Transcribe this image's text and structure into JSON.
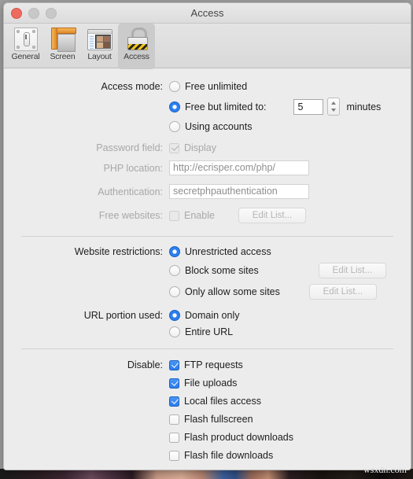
{
  "window": {
    "title": "Access",
    "traffic_lights": [
      "close-button",
      "minimize-button",
      "zoom-button"
    ]
  },
  "toolbar": {
    "tabs": [
      {
        "label": "General",
        "icon": "general-panel-icon",
        "selected": false
      },
      {
        "label": "Screen",
        "icon": "ruler-screen-icon",
        "selected": false
      },
      {
        "label": "Layout",
        "icon": "window-layout-icon",
        "selected": false
      },
      {
        "label": "Access",
        "icon": "padlock-icon",
        "selected": true
      }
    ]
  },
  "sections": {
    "access_mode": {
      "label": "Access mode:",
      "options": [
        {
          "label": "Free unlimited",
          "selected": false
        },
        {
          "label": "Free but limited to:",
          "selected": true
        },
        {
          "label": "Using accounts",
          "selected": false
        }
      ],
      "minutes_value": "5",
      "minutes_unit": "minutes",
      "stepper": "minutes-stepper"
    },
    "password_field": {
      "label": "Password field:",
      "checkbox_label": "Display",
      "checked": true,
      "enabled": false
    },
    "php_location": {
      "label": "PHP location:",
      "value": "http://ecrisper.com/php/",
      "enabled": false
    },
    "authentication": {
      "label": "Authentication:",
      "value": "secretphpauthentication",
      "enabled": false
    },
    "free_websites": {
      "label": "Free websites:",
      "checkbox_label": "Enable",
      "checked": false,
      "enabled": false,
      "button_label": "Edit List..."
    },
    "website_restrictions": {
      "label": "Website restrictions:",
      "options": [
        {
          "label": "Unrestricted access",
          "selected": true,
          "button": null
        },
        {
          "label": "Block some sites",
          "selected": false,
          "button": "Edit List..."
        },
        {
          "label": "Only allow some sites",
          "selected": false,
          "button": "Edit List..."
        }
      ]
    },
    "url_portion": {
      "label": "URL portion used:",
      "options": [
        {
          "label": "Domain only",
          "selected": true
        },
        {
          "label": "Entire URL",
          "selected": false
        }
      ]
    },
    "disable": {
      "label": "Disable:",
      "items": [
        {
          "label": "FTP requests",
          "checked": true
        },
        {
          "label": "File uploads",
          "checked": true
        },
        {
          "label": "Local files access",
          "checked": true
        },
        {
          "label": "Flash fullscreen",
          "checked": false
        },
        {
          "label": "Flash product downloads",
          "checked": false
        },
        {
          "label": "Flash file downloads",
          "checked": false
        }
      ]
    }
  },
  "watermark": "wsxdn.com",
  "colors": {
    "accent_blue": "#2b7ff0",
    "window_bg": "#ececec",
    "disabled_text": "#a8a8a8"
  }
}
